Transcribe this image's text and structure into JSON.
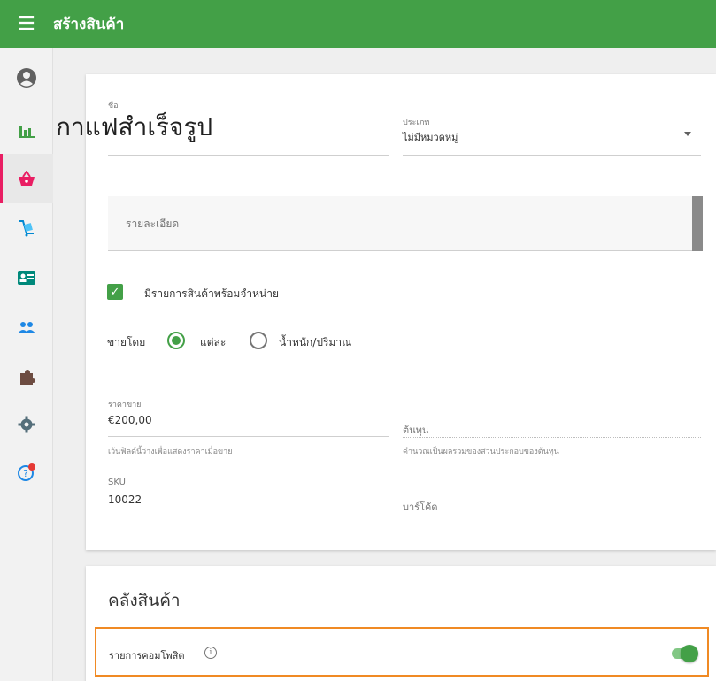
{
  "header": {
    "title": "สร้างสินค้า",
    "menu_icon": "hamburger-menu-icon",
    "color": "#43a047"
  },
  "sidebar": {
    "items": [
      {
        "name": "account-icon",
        "color": "#616161"
      },
      {
        "name": "reports-icon",
        "color": "#43a047"
      },
      {
        "name": "products-icon",
        "color": "#e91e63",
        "active": true
      },
      {
        "name": "inventory-icon",
        "color": "#0288d1"
      },
      {
        "name": "customers-icon",
        "color": "#00897b"
      },
      {
        "name": "employees-icon",
        "color": "#1e88e5"
      },
      {
        "name": "integrations-icon",
        "color": "#6d4c41"
      },
      {
        "name": "settings-icon",
        "color": "#546e7a"
      },
      {
        "name": "help-icon",
        "color": "#1e88e5"
      }
    ]
  },
  "form": {
    "name_label": "ชื่อ",
    "name_value": "กาแฟสำเร็จรูป",
    "category_label": "ประเภท",
    "category_value": "ไม่มีหมวดหมู่",
    "description_placeholder": "รายละเอียด",
    "available_label": "มีรายการสินค้าพร้อมจำหน่าย",
    "available_checked": true,
    "sold_by_label": "ขายโดย",
    "sold_by_options": [
      "แต่ละ",
      "น้ำหนัก/ปริมาณ"
    ],
    "sold_by_selected": "แต่ละ",
    "price_label": "ราคาขาย",
    "price_value": "€200,00",
    "price_hint": "เว้นฟิลด์นี้ว่างเพื่อแสดงราคาเมื่อขาย",
    "cost_placeholder": "ต้นทุน",
    "cost_hint": "คำนวณเป็นผลรวมของส่วนประกอบของต้นทุน",
    "sku_label": "SKU",
    "sku_value": "10022",
    "barcode_placeholder": "บาร์โค้ด"
  },
  "inventory": {
    "title": "คลังสินค้า",
    "composite_label": "รายการคอมโพสิต",
    "composite_on": true
  }
}
